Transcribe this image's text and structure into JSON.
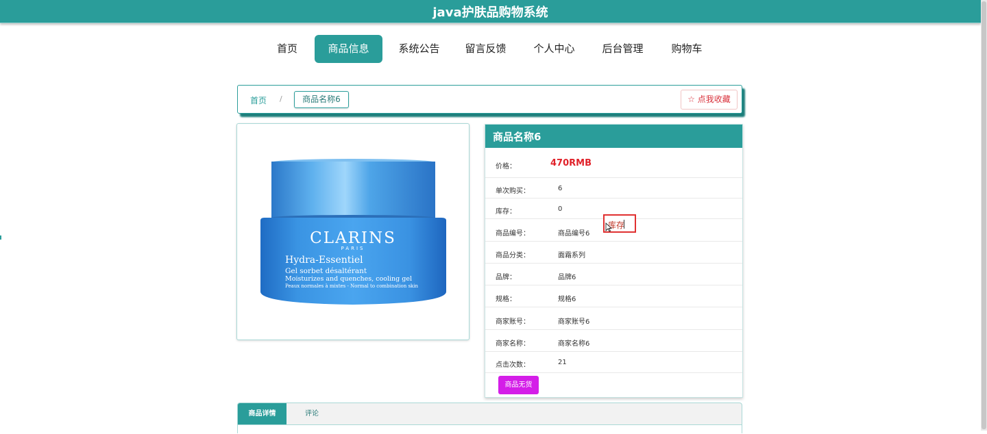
{
  "app": {
    "title": "java护肤品购物系统"
  },
  "nav": {
    "items": [
      {
        "label": "首页",
        "active": false
      },
      {
        "label": "商品信息",
        "active": true
      },
      {
        "label": "系统公告",
        "active": false
      },
      {
        "label": "留言反馈",
        "active": false
      },
      {
        "label": "个人中心",
        "active": false
      },
      {
        "label": "后台管理",
        "active": false
      },
      {
        "label": "购物车",
        "active": false
      }
    ]
  },
  "breadcrumb": {
    "home": "首页",
    "separator": "/",
    "current": "商品名称6",
    "favorite_icon": "star-outline-icon",
    "favorite_label": "☆ 点我收藏"
  },
  "product": {
    "image_alt": "CLARINS PARIS Hydra-Essentiel jar",
    "image_text": {
      "brand": "CLARINS",
      "sub": "PARIS",
      "line": "Hydra-Essentiel",
      "desc1": "Gel sorbet désaltérant",
      "desc2": "Moisturizes and quenches, cooling gel",
      "desc3": "Peaux normales à mixtes - Normal to combination skin"
    },
    "name": "商品名称6",
    "price_label": "价格：",
    "price_value": "470RMB",
    "rows": [
      {
        "label": "单次购买：",
        "value": "6"
      },
      {
        "label": "库存：",
        "value": "0"
      },
      {
        "label": "商品编号：",
        "value": "商品编号6"
      },
      {
        "label": "商品分类：",
        "value": "面霜系列"
      },
      {
        "label": "品牌：",
        "value": "品牌6"
      },
      {
        "label": "规格：",
        "value": "规格6"
      },
      {
        "label": "商家账号：",
        "value": "商家账号6"
      },
      {
        "label": "商家名称：",
        "value": "商家名称6"
      },
      {
        "label": "点击次数：",
        "value": "21"
      }
    ],
    "status_button": "商品无货"
  },
  "inline_edit": {
    "value": "库存"
  },
  "tabs": {
    "items": [
      {
        "label": "商品详情",
        "active": true
      },
      {
        "label": "评论",
        "active": false
      }
    ]
  },
  "colors": {
    "primary": "#2a9d9a",
    "price": "#e0222a",
    "status_button": "#d41ee8",
    "favorite": "#d9303a"
  }
}
